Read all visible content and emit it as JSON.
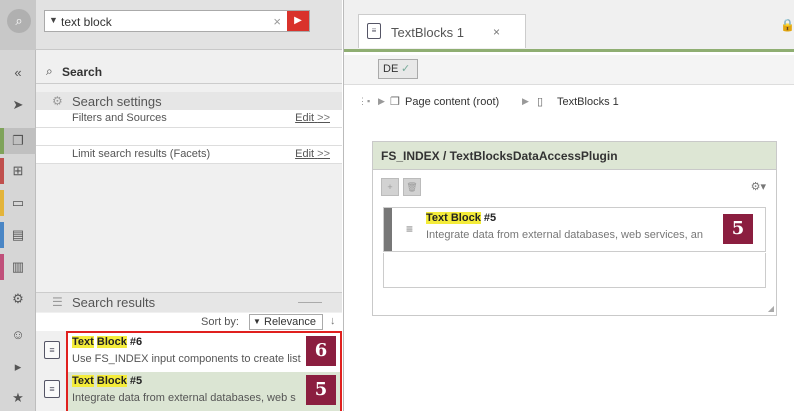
{
  "search": {
    "query": "text block",
    "title": "Search",
    "settings_label": "Search settings",
    "filters_label": "Filters and Sources",
    "filters_edit": "Edit",
    "facets_label": "Limit search results (Facets)",
    "facets_edit": "Edit",
    "edit_arrow": ">>",
    "results_label": "Search results",
    "sort_label": "Sort by:",
    "sort_value": "Relevance",
    "sort_dir": "↓"
  },
  "results": [
    {
      "title_hl1": "Text",
      "title_sep": " ",
      "title_hl2": "Block",
      "title_rest": " #6",
      "desc": "Use FS_INDEX input components to create list",
      "badge": "6"
    },
    {
      "title_hl1": "Text",
      "title_sep": " ",
      "title_hl2": "Block",
      "title_rest": " #5",
      "desc": "Integrate data from external databases, web s",
      "badge": "5"
    }
  ],
  "editor": {
    "tab_label": "TextBlocks 1",
    "tab_close": "×",
    "lang": "DE",
    "breadcrumb": [
      "Page content (root)",
      "TextBlocks 1"
    ],
    "card_title": "FS_INDEX / TextBlocksDataAccessPlugin",
    "item": {
      "title_hl": "Text Block",
      "title_rest": " #5",
      "desc": "Integrate data from external databases, web services, an",
      "badge": "5"
    }
  },
  "colors": {
    "accent_red": "#d9322b",
    "badge": "#8b1e3f",
    "highlight": "#f4ec3a",
    "green_border": "#8fae72"
  }
}
